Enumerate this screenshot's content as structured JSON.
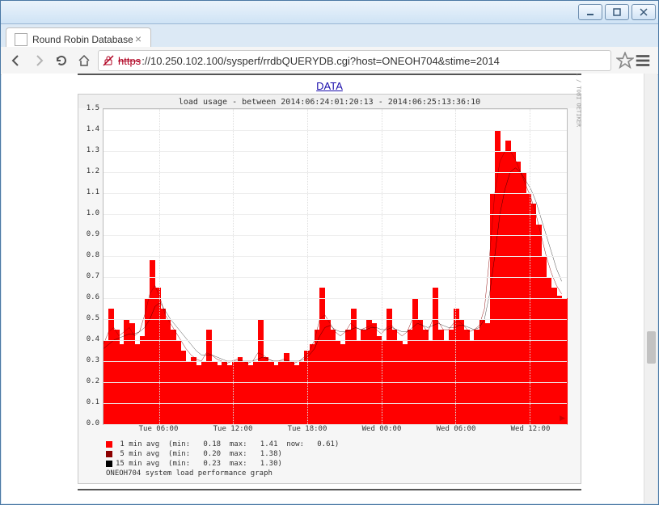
{
  "window": {
    "tab_title": "Round Robin Database Qu",
    "ssl_warning_struck": "https",
    "url_display": "://10.250.102.100/sysperf/rrdbQUERYDB.cgi?host=ONEOH704&stime=2014"
  },
  "page": {
    "data_link_label": "DATA",
    "chart_title": "load usage - between 2014:06:24:01:20:13 - 2014:06:25:13:36:10",
    "footer_caption": "ONEOH704 system load performance graph",
    "rrd_watermark": "RRDTOOL / TOBI OETIKER",
    "legend": [
      {
        "color": "#ff0000",
        "label": " 1 min avg  (min:   0.18  max:   1.41  now:   0.61)"
      },
      {
        "color": "#8b0000",
        "label": " 5 min avg  (min:   0.20  max:   1.38)"
      },
      {
        "color": "#000000",
        "label": "15 min avg  (min:   0.23  max:   1.30)"
      }
    ]
  },
  "chart_data": {
    "type": "area",
    "title": "load usage - between 2014:06:24:01:20:13 - 2014:06:25:13:36:10",
    "xlabel": "",
    "ylabel": "",
    "ylim": [
      0,
      1.5
    ],
    "yticks": [
      0.0,
      0.1,
      0.2,
      0.3,
      0.4,
      0.5,
      0.6,
      0.7,
      0.8,
      0.9,
      1.0,
      1.1,
      1.2,
      1.3,
      1.4,
      1.5
    ],
    "x_tick_labels": [
      "Tue 06:00",
      "Tue 12:00",
      "Tue 18:00",
      "Wed 00:00",
      "Wed 06:00",
      "Wed 12:00"
    ],
    "x_tick_positions_pct": [
      12,
      28,
      44,
      60,
      76,
      92
    ],
    "series": [
      {
        "name": "1 min avg",
        "color": "#ff0000",
        "render": "area",
        "values": [
          0.4,
          0.55,
          0.45,
          0.38,
          0.5,
          0.48,
          0.38,
          0.42,
          0.6,
          0.78,
          0.65,
          0.55,
          0.5,
          0.45,
          0.4,
          0.35,
          0.3,
          0.32,
          0.28,
          0.3,
          0.45,
          0.3,
          0.28,
          0.3,
          0.28,
          0.3,
          0.32,
          0.3,
          0.28,
          0.3,
          0.5,
          0.32,
          0.3,
          0.28,
          0.3,
          0.34,
          0.3,
          0.28,
          0.3,
          0.35,
          0.38,
          0.45,
          0.65,
          0.5,
          0.45,
          0.4,
          0.38,
          0.45,
          0.55,
          0.4,
          0.45,
          0.5,
          0.48,
          0.42,
          0.4,
          0.55,
          0.45,
          0.4,
          0.38,
          0.45,
          0.6,
          0.5,
          0.45,
          0.4,
          0.65,
          0.45,
          0.4,
          0.45,
          0.55,
          0.5,
          0.45,
          0.4,
          0.45,
          0.5,
          0.48,
          1.1,
          1.4,
          1.3,
          1.35,
          1.3,
          1.25,
          1.2,
          1.1,
          1.05,
          0.95,
          0.8,
          0.7,
          0.65,
          0.61,
          0.6
        ]
      },
      {
        "name": "5 min avg",
        "color": "#8b0000",
        "render": "line",
        "values": [
          0.38,
          0.44,
          0.46,
          0.42,
          0.44,
          0.46,
          0.42,
          0.44,
          0.52,
          0.62,
          0.66,
          0.6,
          0.52,
          0.48,
          0.44,
          0.4,
          0.36,
          0.33,
          0.31,
          0.3,
          0.34,
          0.33,
          0.31,
          0.3,
          0.29,
          0.3,
          0.31,
          0.3,
          0.29,
          0.3,
          0.34,
          0.33,
          0.31,
          0.3,
          0.3,
          0.31,
          0.3,
          0.29,
          0.3,
          0.32,
          0.35,
          0.4,
          0.5,
          0.52,
          0.48,
          0.44,
          0.42,
          0.44,
          0.48,
          0.46,
          0.45,
          0.46,
          0.47,
          0.45,
          0.43,
          0.46,
          0.47,
          0.44,
          0.42,
          0.44,
          0.5,
          0.5,
          0.47,
          0.44,
          0.5,
          0.49,
          0.45,
          0.45,
          0.48,
          0.49,
          0.47,
          0.44,
          0.45,
          0.47,
          0.55,
          0.8,
          1.1,
          1.25,
          1.3,
          1.3,
          1.26,
          1.2,
          1.14,
          1.08,
          1.0,
          0.9,
          0.8,
          0.72,
          0.66,
          0.62
        ]
      },
      {
        "name": "15 min avg",
        "color": "#000000",
        "render": "line",
        "values": [
          0.36,
          0.38,
          0.4,
          0.41,
          0.42,
          0.43,
          0.43,
          0.44,
          0.46,
          0.5,
          0.56,
          0.58,
          0.54,
          0.5,
          0.47,
          0.44,
          0.41,
          0.38,
          0.35,
          0.33,
          0.33,
          0.33,
          0.32,
          0.31,
          0.3,
          0.3,
          0.3,
          0.3,
          0.3,
          0.3,
          0.31,
          0.32,
          0.31,
          0.3,
          0.3,
          0.3,
          0.3,
          0.3,
          0.3,
          0.31,
          0.33,
          0.36,
          0.42,
          0.46,
          0.47,
          0.45,
          0.44,
          0.44,
          0.45,
          0.46,
          0.45,
          0.45,
          0.46,
          0.46,
          0.45,
          0.45,
          0.46,
          0.45,
          0.44,
          0.44,
          0.46,
          0.48,
          0.47,
          0.46,
          0.47,
          0.48,
          0.47,
          0.46,
          0.46,
          0.47,
          0.47,
          0.46,
          0.45,
          0.46,
          0.5,
          0.62,
          0.8,
          1.0,
          1.12,
          1.2,
          1.22,
          1.2,
          1.16,
          1.12,
          1.06,
          0.98,
          0.9,
          0.82,
          0.74,
          0.68
        ]
      }
    ]
  }
}
